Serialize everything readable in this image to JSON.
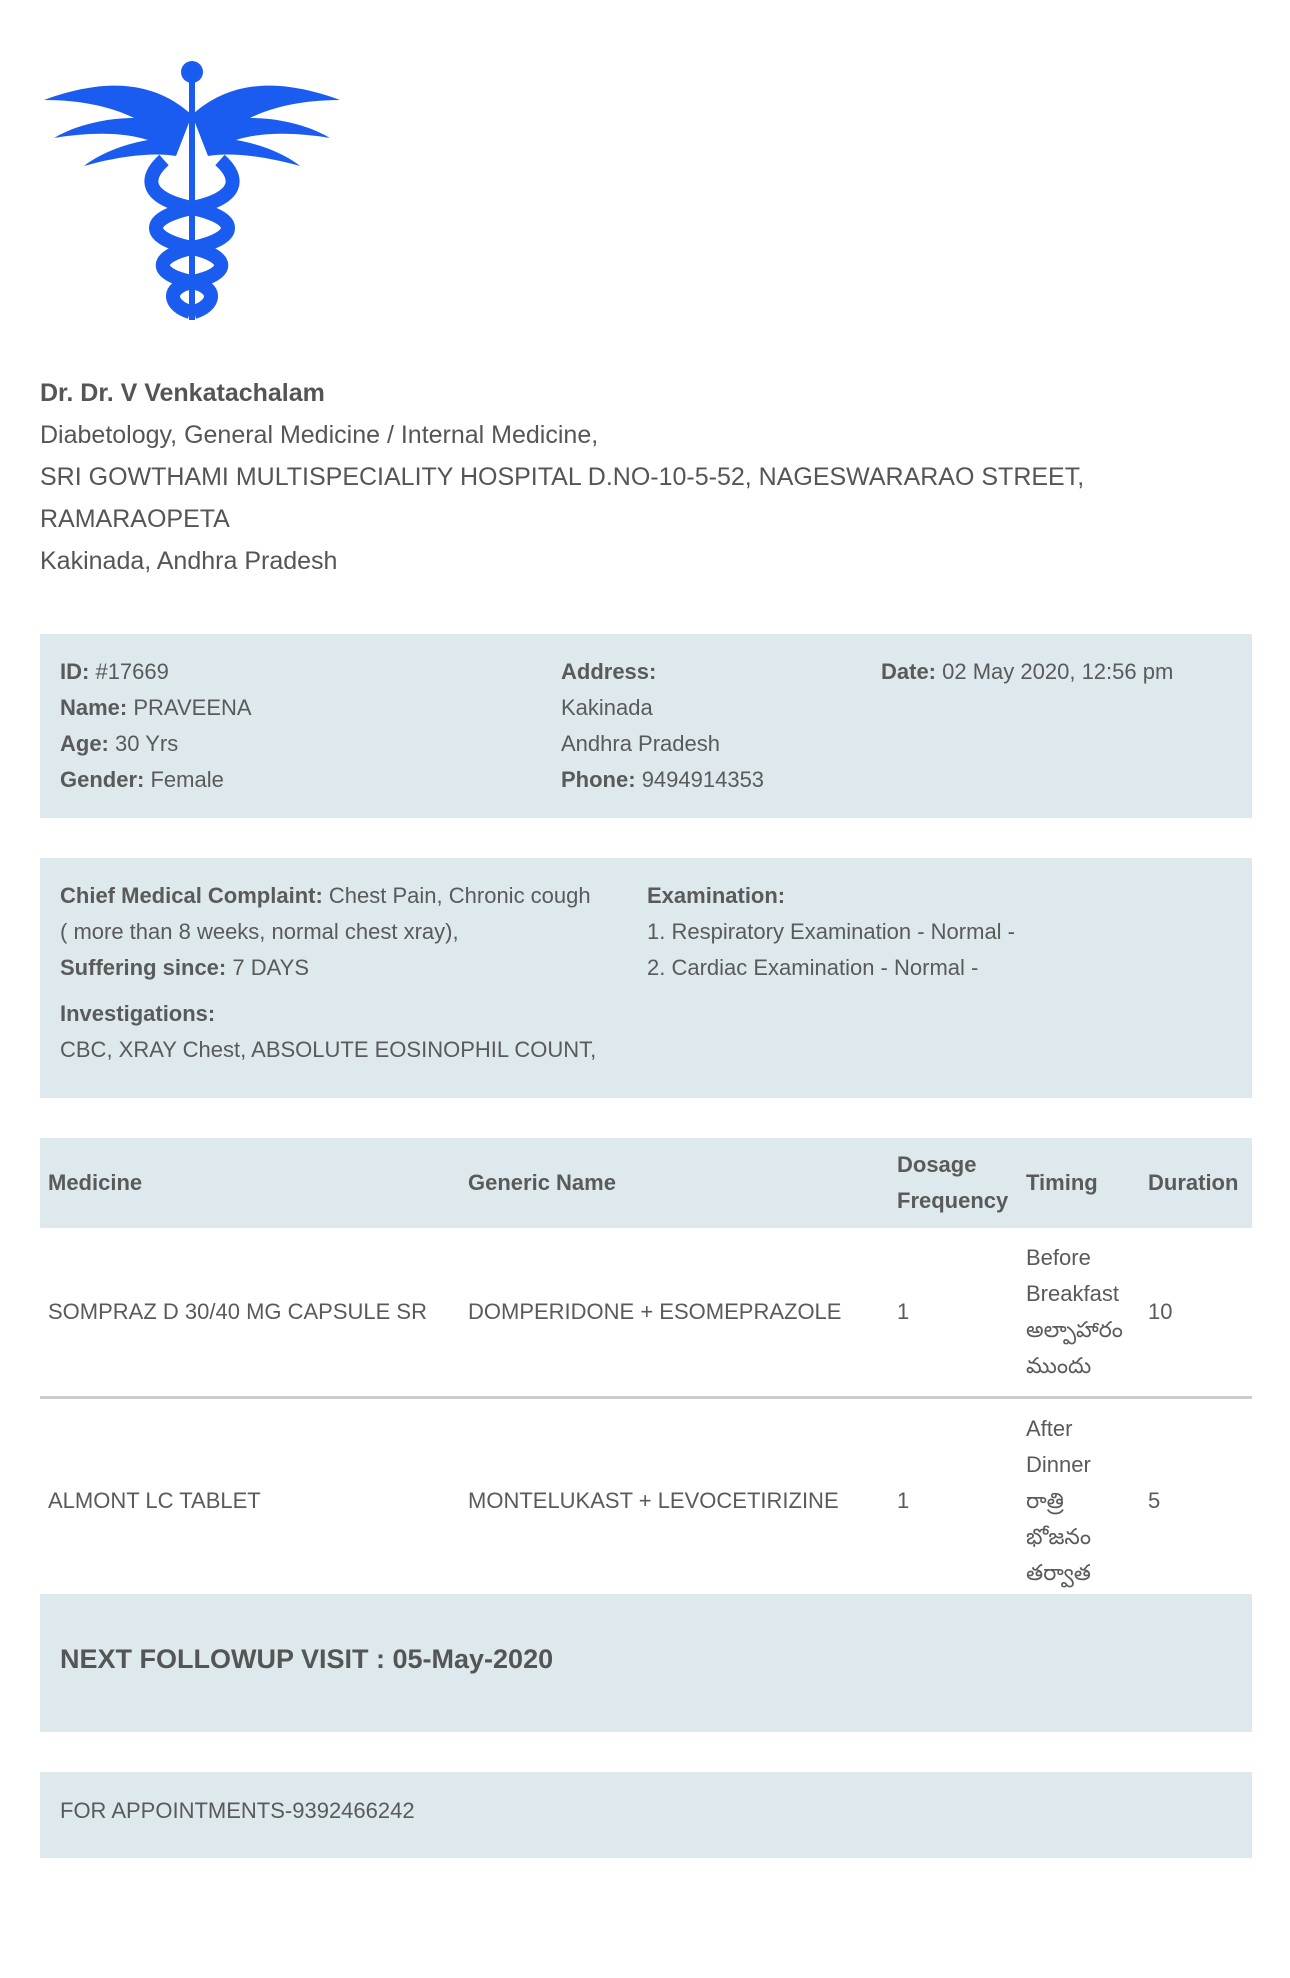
{
  "colors": {
    "logo": "#1a5cf0",
    "panel_bg": "#dde9ec",
    "text": "#5a5a5a",
    "divider": "#cccccc"
  },
  "logo_icon": "caduceus-icon",
  "doctor": {
    "name": "Dr. Dr. V Venkatachalam",
    "specialty": "Diabetology, General Medicine / Internal Medicine,",
    "hospital_line1": "SRI GOWTHAMI MULTISPECIALITY HOSPITAL D.NO-10-5-52, NAGESWARARAO STREET,",
    "hospital_line2": "RAMARAOPETA",
    "city": "Kakinada, Andhra Pradesh"
  },
  "patient": {
    "id_label": "ID:",
    "id": "#17669",
    "name_label": "Name:",
    "name": "PRAVEENA",
    "age_label": "Age:",
    "age": "30 Yrs",
    "gender_label": "Gender:",
    "gender": "Female",
    "address_label": "Address:",
    "address_line1": "Kakinada",
    "address_line2": "Andhra Pradesh",
    "phone_label": "Phone:",
    "phone": "9494914353",
    "date_label": "Date:",
    "date": "02 May 2020, 12:56 pm"
  },
  "clinical": {
    "complaint_label": "Chief Medical Complaint:",
    "complaint": "Chest Pain, Chronic cough ( more than 8 weeks, normal chest xray),",
    "suffering_label": "Suffering since:",
    "suffering": "7 DAYS",
    "investigations_label": "Investigations:",
    "investigations": "CBC, XRAY Chest, ABSOLUTE EOSINOPHIL COUNT,",
    "examination_label": "Examination:",
    "examination": [
      "1. Respiratory Examination - Normal -",
      "2. Cardiac Examination - Normal -"
    ]
  },
  "medicines": {
    "headers": {
      "medicine": "Medicine",
      "generic": "Generic Name",
      "dosage_1": "Dosage",
      "dosage_2": "Frequency",
      "timing": "Timing",
      "duration": "Duration"
    },
    "rows": [
      {
        "medicine": "SOMPRAZ D 30/40 MG CAPSULE SR",
        "generic": "DOMPERIDONE + ESOMEPRAZOLE",
        "dosage": "1",
        "timing_lines": [
          "Before",
          "Breakfast",
          "అల్పాహారం",
          "ముందు"
        ],
        "duration": "10"
      },
      {
        "medicine": "ALMONT LC TABLET",
        "generic": "MONTELUKAST + LEVOCETIRIZINE",
        "dosage": "1",
        "timing_lines": [
          "After",
          "Dinner",
          "రాత్రి",
          "భోజనం",
          "తర్వాత"
        ],
        "duration": "5"
      }
    ]
  },
  "followup": "NEXT FOLLOWUP VISIT : 05-May-2020",
  "appointments": "FOR APPOINTMENTS-9392466242"
}
